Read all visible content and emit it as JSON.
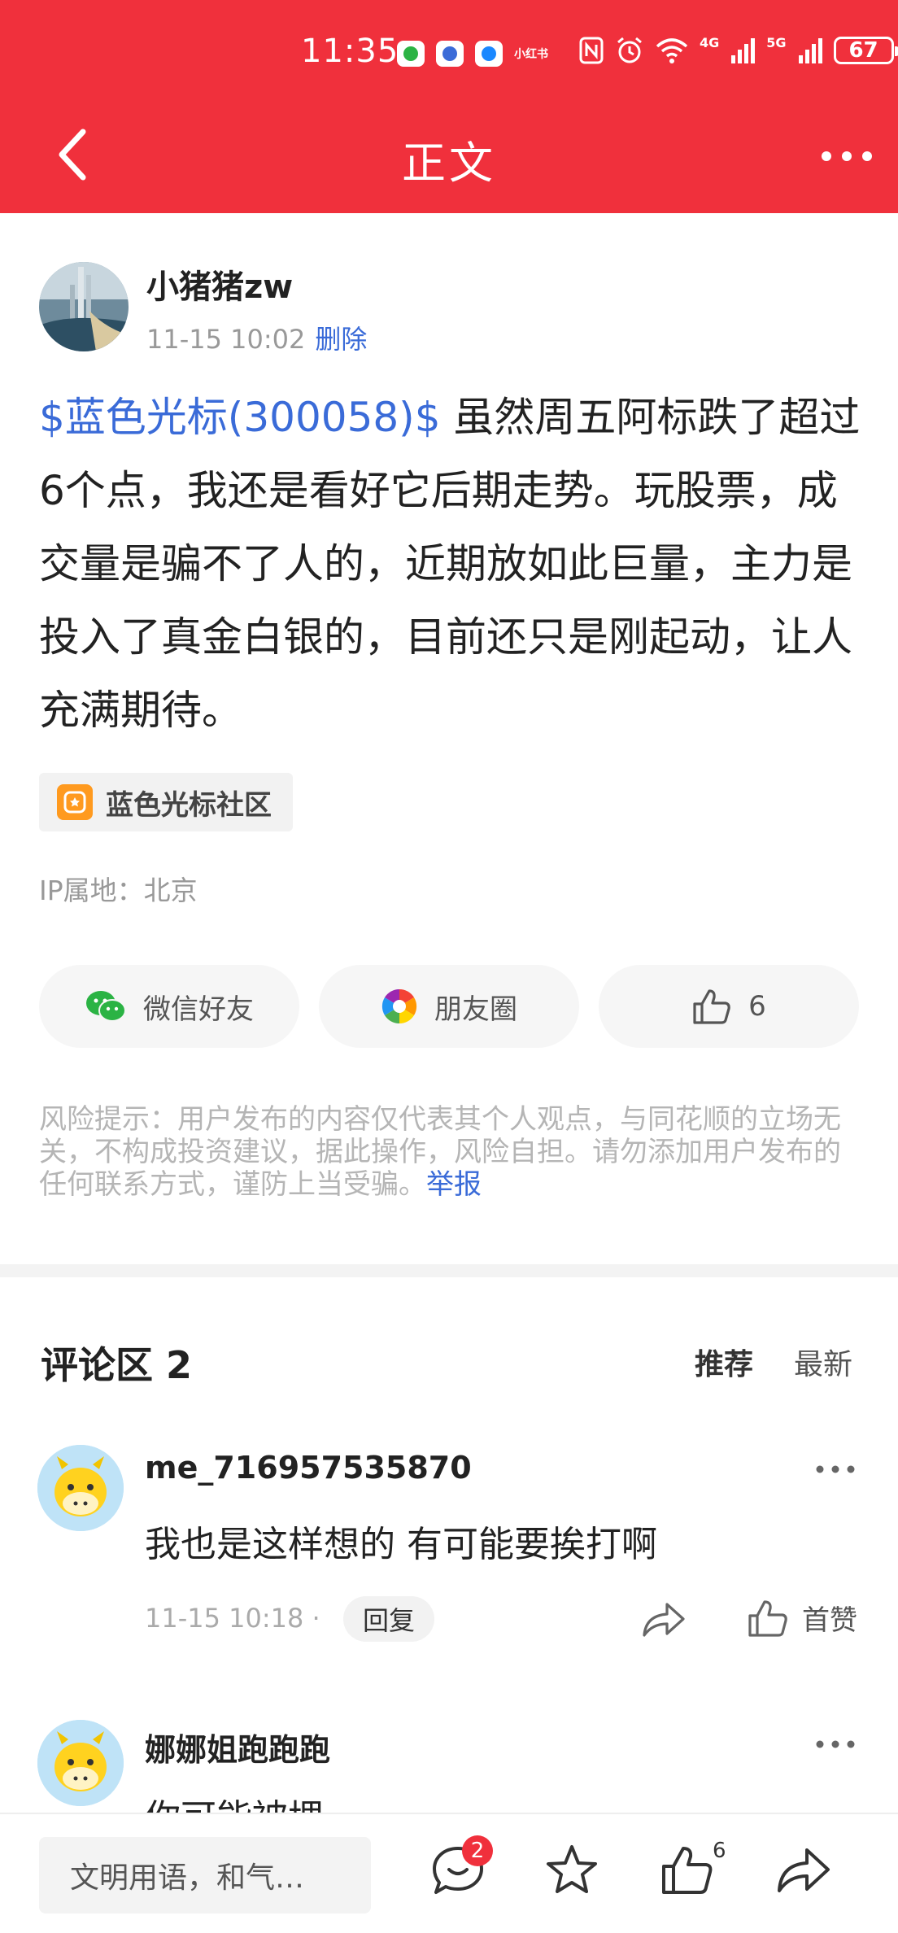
{
  "status_bar": {
    "time": "11:35",
    "battery": "67",
    "network_a": "4G",
    "network_b": "5G",
    "app_small": "小红书"
  },
  "header": {
    "title": "正文"
  },
  "post": {
    "author": "小猪猪zw",
    "time": "11-15 10:02",
    "delete_label": "删除",
    "stock_link": "$蓝色光标(300058)$",
    "body": " 虽然周五阿标跌了超过6个点，我还是看好它后期走势。玩股票，成交量是骗不了人的，近期放如此巨量，主力是投入了真金白银的，目前还只是刚起动，让人充满期待。",
    "community": "蓝色光标社区",
    "ip_location": "IP属地：北京"
  },
  "share": {
    "wechat": "微信好友",
    "moments": "朋友圈",
    "like_count": "6"
  },
  "risk": {
    "text": "风险提示：用户发布的内容仅代表其个人观点，与同花顺的立场无关，不构成投资建议，据此操作，风险自担。请勿添加用户发布的任何联系方式，谨防上当受骗。",
    "report": "举报"
  },
  "comments": {
    "title": "评论区 2",
    "sort_hot": "推荐",
    "sort_new": "最新",
    "items": [
      {
        "name": "me_716957535870",
        "text": "我也是这样想的 有可能要挨打啊",
        "time": "11-15 10:18 ·",
        "reply": "回复",
        "like_label": "首赞"
      },
      {
        "name": "娜娜姐跑跑跑",
        "text": "你可能被埋"
      }
    ]
  },
  "bottom_bar": {
    "input_placeholder": "文明用语，和气…",
    "comment_badge": "2",
    "like_count": "6"
  },
  "colors": {
    "brand_red": "#f0303c",
    "link_blue": "#3a6bd8"
  },
  "icons": [
    "back-icon",
    "more-icon",
    "wechat-icon",
    "moments-icon",
    "thumb-up-icon",
    "share-icon",
    "comment-icon",
    "star-icon"
  ]
}
